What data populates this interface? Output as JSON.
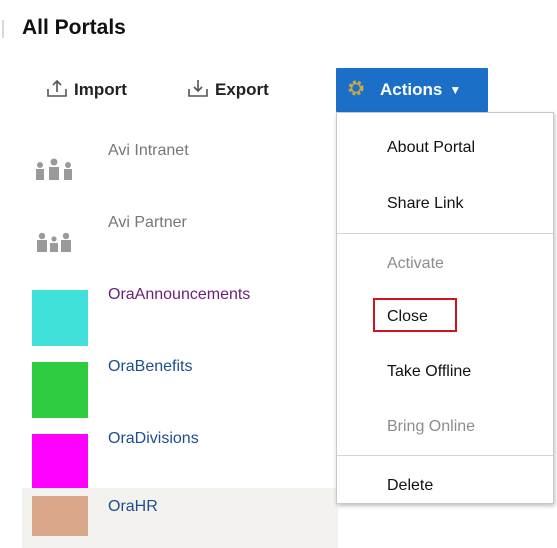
{
  "page": {
    "title": "All Portals"
  },
  "toolbar": {
    "import_label": "Import",
    "export_label": "Export",
    "actions_label": "Actions",
    "actions_color": "#1b6fc7"
  },
  "portals": [
    {
      "name": "Avi Intranet",
      "icon": "people-icon"
    },
    {
      "name": "Avi Partner",
      "icon": "people-icon"
    },
    {
      "name": "OraAnnouncements",
      "color": "#40e0da"
    },
    {
      "name": "OraBenefits",
      "color": "#2ecc40"
    },
    {
      "name": "OraDivisions",
      "color": "#ff00ff"
    },
    {
      "name": "OraHR",
      "color": "#d8a888"
    }
  ],
  "actions_menu": {
    "items": [
      {
        "label": "About Portal",
        "enabled": true
      },
      {
        "label": "Share Link",
        "enabled": true
      },
      {
        "label": "Activate",
        "enabled": false
      },
      {
        "label": "Close",
        "enabled": true,
        "highlighted": true
      },
      {
        "label": "Take Offline",
        "enabled": true
      },
      {
        "label": "Bring Online",
        "enabled": false
      },
      {
        "label": "Delete",
        "enabled": true
      }
    ],
    "highlight_color": "#d0161c"
  }
}
